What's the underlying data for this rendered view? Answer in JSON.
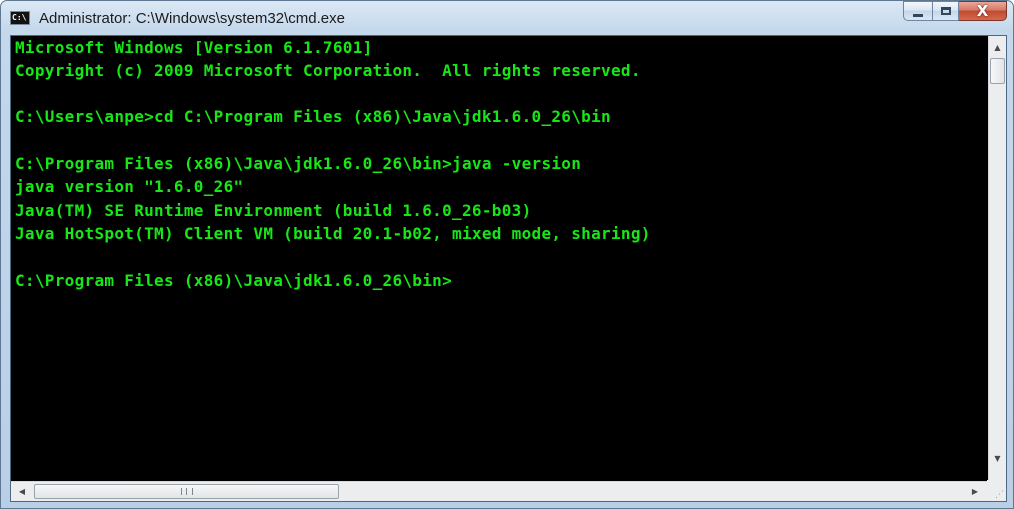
{
  "window": {
    "title": "Administrator: C:\\Windows\\system32\\cmd.exe",
    "icon_label": "C:\\",
    "icon": "cmd-app-icon",
    "caption_buttons": {
      "minimize_icon": "minimize-icon",
      "maximize_icon": "maximize-icon",
      "close_icon": "close-icon",
      "close_glyph": "X"
    }
  },
  "console": {
    "text_color": "#17e617",
    "background": "#000000",
    "lines": [
      "Microsoft Windows [Version 6.1.7601]",
      "Copyright (c) 2009 Microsoft Corporation.  All rights reserved.",
      "",
      "C:\\Users\\anpe>cd C:\\Program Files (x86)\\Java\\jdk1.6.0_26\\bin",
      "",
      "C:\\Program Files (x86)\\Java\\jdk1.6.0_26\\bin>java -version",
      "java version \"1.6.0_26\"",
      "Java(TM) SE Runtime Environment (build 1.6.0_26-b03)",
      "Java HotSpot(TM) Client VM (build 20.1-b02, mixed mode, sharing)",
      "",
      "C:\\Program Files (x86)\\Java\\jdk1.6.0_26\\bin>"
    ]
  },
  "scrollbars": {
    "up_glyph": "▲",
    "down_glyph": "▼",
    "left_glyph": "◀",
    "right_glyph": "▶"
  }
}
